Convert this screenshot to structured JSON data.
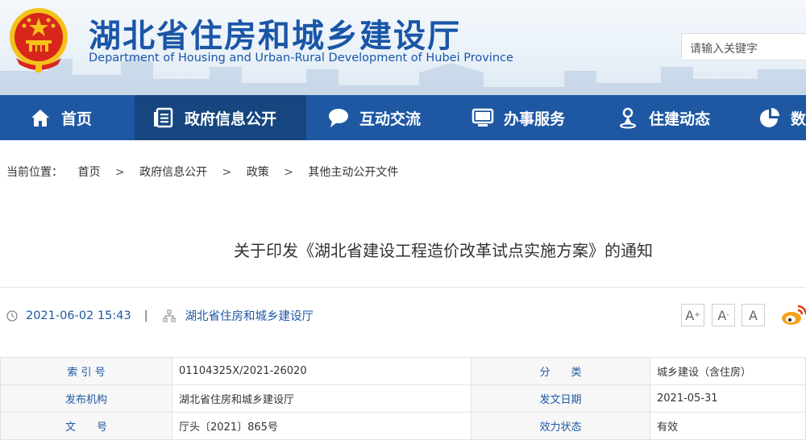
{
  "header": {
    "title": "湖北省住房和城乡建设厅",
    "subtitle": "Department of Housing and Urban-Rural Development of Hubei Province",
    "search_placeholder": "请输入关键字"
  },
  "nav": {
    "items": [
      {
        "label": "首页",
        "icon": "home-icon"
      },
      {
        "label": "政府信息公开",
        "icon": "document-list-icon",
        "active": true
      },
      {
        "label": "互动交流",
        "icon": "chat-bubble-icon"
      },
      {
        "label": "办事服务",
        "icon": "monitor-icon"
      },
      {
        "label": "住建动态",
        "icon": "person-pin-icon"
      },
      {
        "label": "数",
        "icon": "pie-chart-icon"
      }
    ]
  },
  "breadcrumb": {
    "prefix": "当前位置：",
    "items": [
      "首页",
      "政府信息公开",
      "政策",
      "其他主动公开文件"
    ],
    "separator": ">"
  },
  "document": {
    "title": "关于印发《湖北省建设工程造价改革试点实施方案》的通知",
    "datetime": "2021-06-02 15:43",
    "meta_separator": "|",
    "source": "湖北省住房和城乡建设厅"
  },
  "font_controls": {
    "larger": "A",
    "smaller": "A",
    "normal": "A"
  },
  "info_table": {
    "rows": [
      {
        "k1": "索 引 号",
        "v1": "01104325X/2021-26020",
        "k2": "分　　类",
        "v2": "城乡建设（含住房）"
      },
      {
        "k1": "发布机构",
        "v1": "湖北省住房和城乡建设厅",
        "k2": "发文日期",
        "v2": "2021-05-31"
      },
      {
        "k1": "文　　号",
        "v1": "厅头〔2021〕865号",
        "k2": "效力状态",
        "v2": "有效"
      }
    ]
  },
  "colors": {
    "brand_blue": "#1e58a3",
    "nav_active": "#16467f",
    "emblem_red": "#d8261c",
    "emblem_gold": "#f5c21b",
    "weibo_orange": "#f4a21b"
  }
}
